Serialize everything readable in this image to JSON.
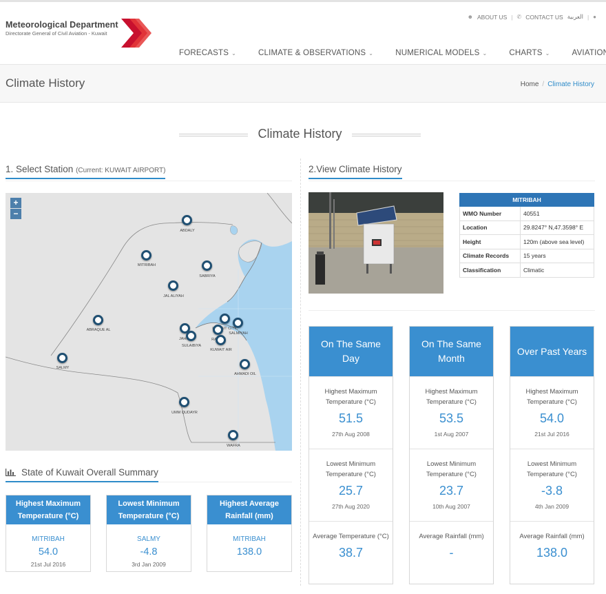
{
  "header": {
    "logo_title": "Meteorological Department",
    "logo_subtitle": "Directorate General of Civil Aviation - Kuwait",
    "util_links": {
      "about": "ABOUT US",
      "contact": "CONTACT US",
      "arabic": "العربية"
    },
    "nav": [
      {
        "label": "FORECASTS"
      },
      {
        "label": "CLIMATE & OBSERVATIONS"
      },
      {
        "label": "NUMERICAL MODELS"
      },
      {
        "label": "CHARTS"
      },
      {
        "label": "AVIATION"
      }
    ]
  },
  "titlebar": {
    "title": "Climate History",
    "breadcrumb": {
      "home": "Home",
      "current": "Climate History"
    }
  },
  "section_title": "Climate History",
  "select_station": {
    "label": "1. Select Station",
    "current": "(Current: KUWAIT AIRPORT)"
  },
  "map": {
    "zoom_in": "+",
    "zoom_out": "−",
    "stations": [
      {
        "name": "ABDALY"
      },
      {
        "name": "MITRIBAH"
      },
      {
        "name": "SABRIYA"
      },
      {
        "name": "JAL ALIYAH"
      },
      {
        "name": "ABRAQUE AL"
      },
      {
        "name": "JAHRA"
      },
      {
        "name": "SULAIBIYA"
      },
      {
        "name": "KUWAIT CITY"
      },
      {
        "name": "SALMIYAH"
      },
      {
        "name": "RABIYA"
      },
      {
        "name": "KUWAIT AIR"
      },
      {
        "name": "SALMY"
      },
      {
        "name": "AHMADI OIL"
      },
      {
        "name": "UMM QUDAYR"
      },
      {
        "name": "WAFRA"
      }
    ]
  },
  "summary": {
    "heading": "State of Kuwait Overall Summary",
    "cards": [
      {
        "header": "Highest Maximum Temperature (°C)",
        "station": "MITRIBAH",
        "value": "54.0",
        "date": "21st Jul 2016"
      },
      {
        "header": "Lowest Minimum Temperature (°C)",
        "station": "SALMY",
        "value": "-4.8",
        "date": "3rd Jan 2009"
      },
      {
        "header": "Highest Average Rainfall (mm)",
        "station": "MITRIBAH",
        "value": "138.0",
        "date": ""
      }
    ]
  },
  "view_history": {
    "label": "2.View Climate History"
  },
  "station_info": {
    "name": "MITRIBAH",
    "rows": [
      {
        "key": "WMO Number",
        "value": "40551"
      },
      {
        "key": "Location",
        "value": "29.8247° N,47.3598° E"
      },
      {
        "key": "Height",
        "value": "120m (above sea level)"
      },
      {
        "key": "Climate Records",
        "value": "15 years"
      },
      {
        "key": "Classification",
        "value": "Climatic"
      }
    ]
  },
  "history": [
    {
      "header": "On The Same Day",
      "cells": [
        {
          "label": "Highest Maximum Temperature (°C)",
          "value": "51.5",
          "date": "27th Aug 2008"
        },
        {
          "label": "Lowest Minimum Temperature (°C)",
          "value": "25.7",
          "date": "27th Aug 2020"
        },
        {
          "label": "Average Temperature (°C)",
          "value": "38.7",
          "date": ""
        }
      ]
    },
    {
      "header": "On The Same Month",
      "cells": [
        {
          "label": "Highest Maximum Temperature (°C)",
          "value": "53.5",
          "date": "1st Aug 2007"
        },
        {
          "label": "Lowest Minimum Temperature (°C)",
          "value": "23.7",
          "date": "10th Aug 2007"
        },
        {
          "label": "Average Rainfall (mm)",
          "value": "-",
          "date": ""
        }
      ]
    },
    {
      "header": "Over Past Years",
      "cells": [
        {
          "label": "Highest Maximum Temperature (°C)",
          "value": "54.0",
          "date": "21st Jul 2016"
        },
        {
          "label": "Lowest Minimum Temperature (°C)",
          "value": "-3.8",
          "date": "4th Jan 2009"
        },
        {
          "label": "Average Rainfall (mm)",
          "value": "138.0",
          "date": ""
        }
      ]
    }
  ],
  "colors": {
    "accent": "#3a8fd0",
    "table_header": "#2e75b6",
    "sea": "#a9d3ef",
    "land": "#e4e4e4",
    "marker": "#1f4f72"
  }
}
